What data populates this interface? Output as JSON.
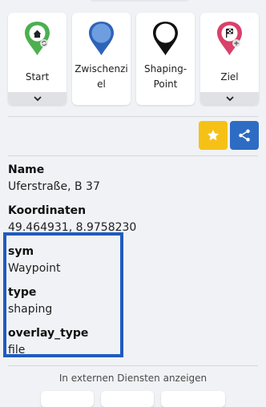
{
  "waypoint_cards": [
    {
      "label": "Start",
      "pin_color": "#4caf50",
      "icon": "home-icon",
      "badge": "refresh-icon"
    },
    {
      "label": "Zwischenziel",
      "pin_color": "#2f63b8",
      "icon": "",
      "badge": ""
    },
    {
      "label": "Shaping-Point",
      "pin_color": "#111111",
      "icon": "",
      "badge": ""
    },
    {
      "label": "Ziel",
      "pin_color": "#d9416a",
      "icon": "flag-checkered-icon",
      "badge": "plus-icon"
    }
  ],
  "actions": {
    "favorite_icon": "star-icon",
    "share_icon": "share-icon"
  },
  "properties": [
    {
      "key": "Name",
      "value": "Uferstraße, B 37"
    },
    {
      "key": "Koordinaten",
      "value": "49.464931, 8.9758230"
    },
    {
      "key": "sym",
      "value": "Waypoint"
    },
    {
      "key": "type",
      "value": "shaping"
    },
    {
      "key": "overlay_type",
      "value": "file"
    }
  ],
  "external_services": {
    "label": "In externen Diensten anzeigen"
  },
  "colors": {
    "background": "#f0f2f5",
    "star_button": "#f6c117",
    "share_button": "#2e6cc4",
    "highlight_box": "#1f5bbf"
  }
}
